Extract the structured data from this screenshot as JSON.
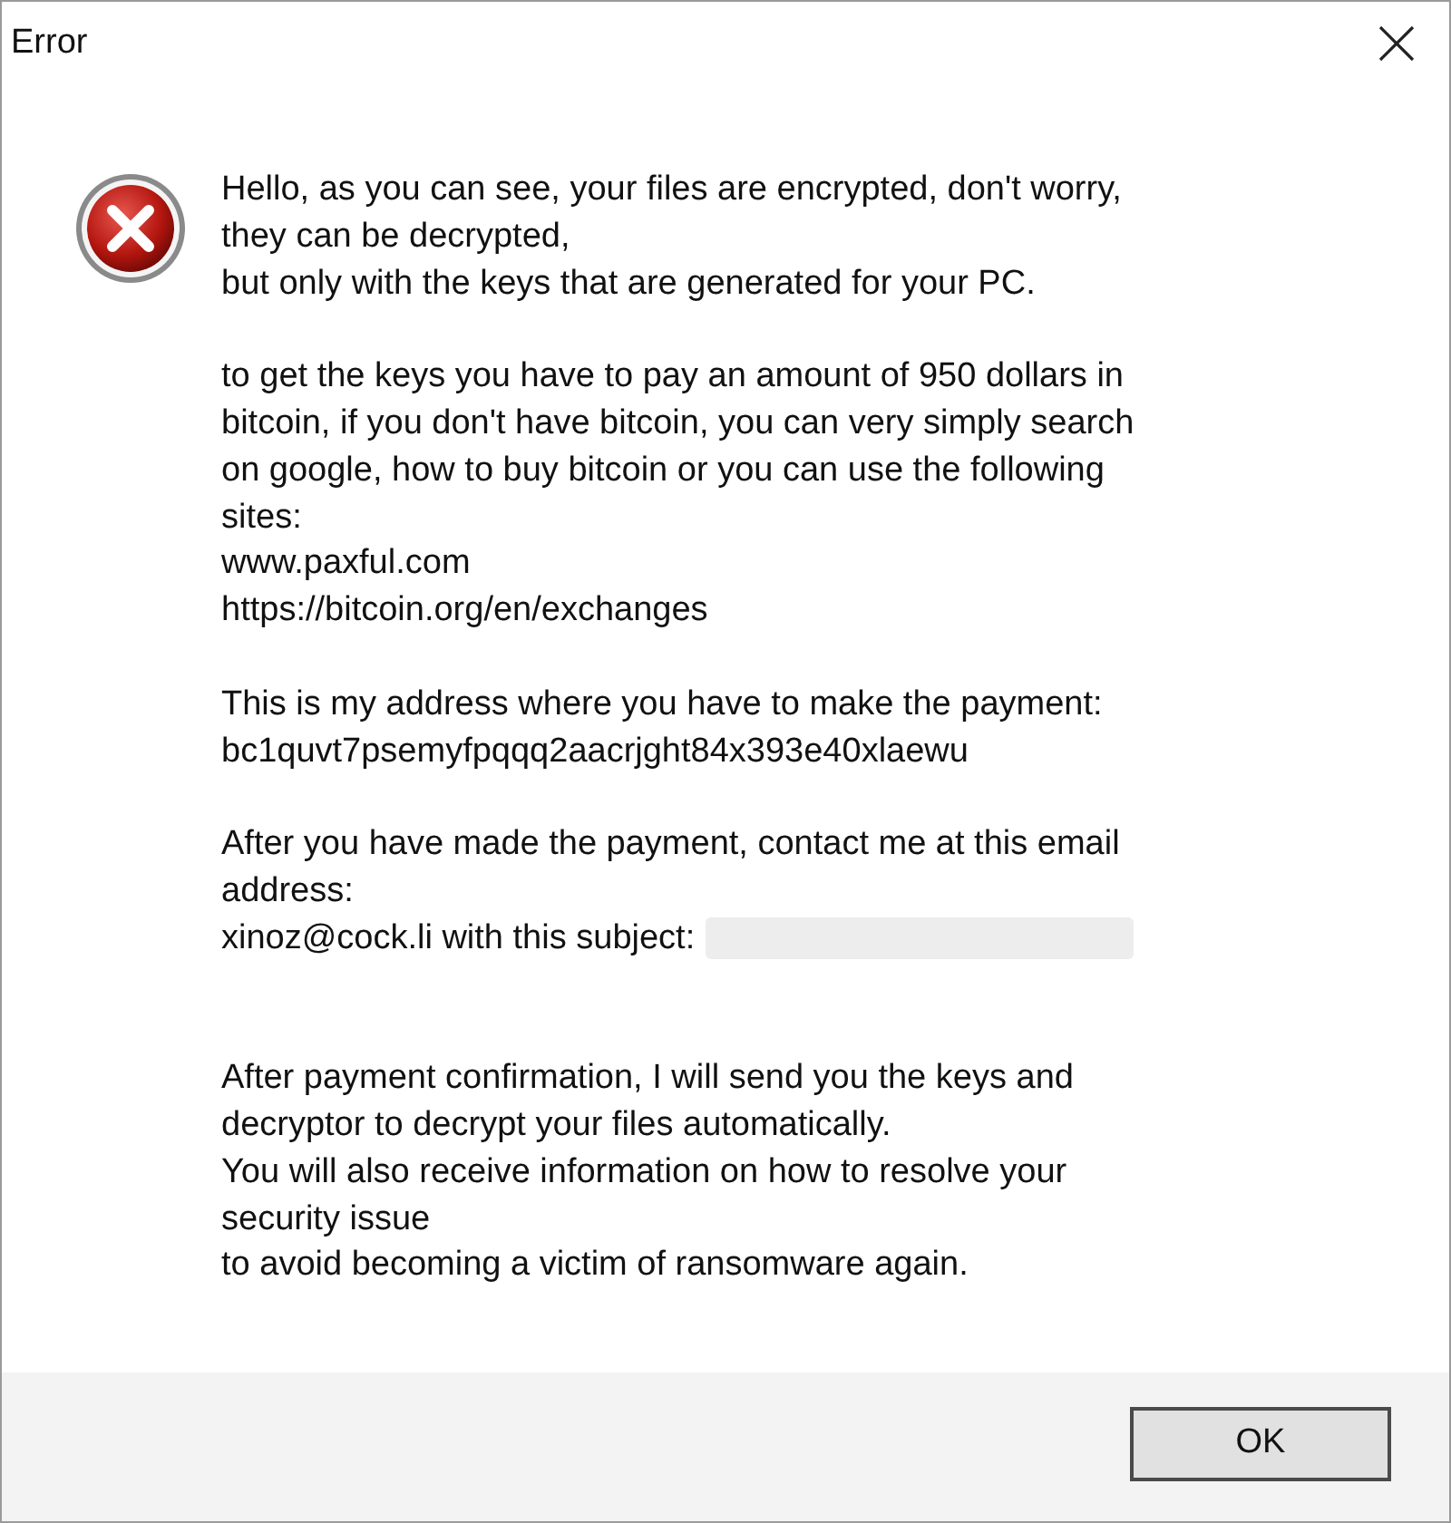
{
  "window": {
    "title": "Error"
  },
  "message": {
    "paragraphs": [
      {
        "kind": "plain",
        "lines": [
          "Hello, as you can see, your files are encrypted, don't worry,",
          "they can be decrypted,",
          "but only with the keys that are generated for your PC."
        ]
      },
      {
        "kind": "plain",
        "lines": [
          "to get the keys you have to pay an amount of 950 dollars in",
          "bitcoin, if you don't have bitcoin, you can very simply search",
          "on google, how to buy bitcoin or you can use the following",
          "sites:",
          "www.paxful.com",
          "https://bitcoin.org/en/exchanges"
        ]
      },
      {
        "kind": "plain",
        "lines": [
          "This is my address where you have to make the payment:",
          "bc1quvt7psemyfpqqq2aacrjght84x393e40xlaewu"
        ]
      },
      {
        "kind": "redacted",
        "lines": [
          "After you have made the payment, contact me at this email",
          "address:",
          "xinoz@cock.li with this subject:"
        ]
      },
      {
        "kind": "plain",
        "lines": [
          "After payment confirmation, I will send you the keys and",
          "decryptor to decrypt your files automatically.",
          "You will also receive information on how to resolve your",
          "security issue",
          "to avoid becoming a victim of ransomware again."
        ]
      }
    ]
  },
  "buttons": [
    {
      "label": "OK"
    }
  ]
}
